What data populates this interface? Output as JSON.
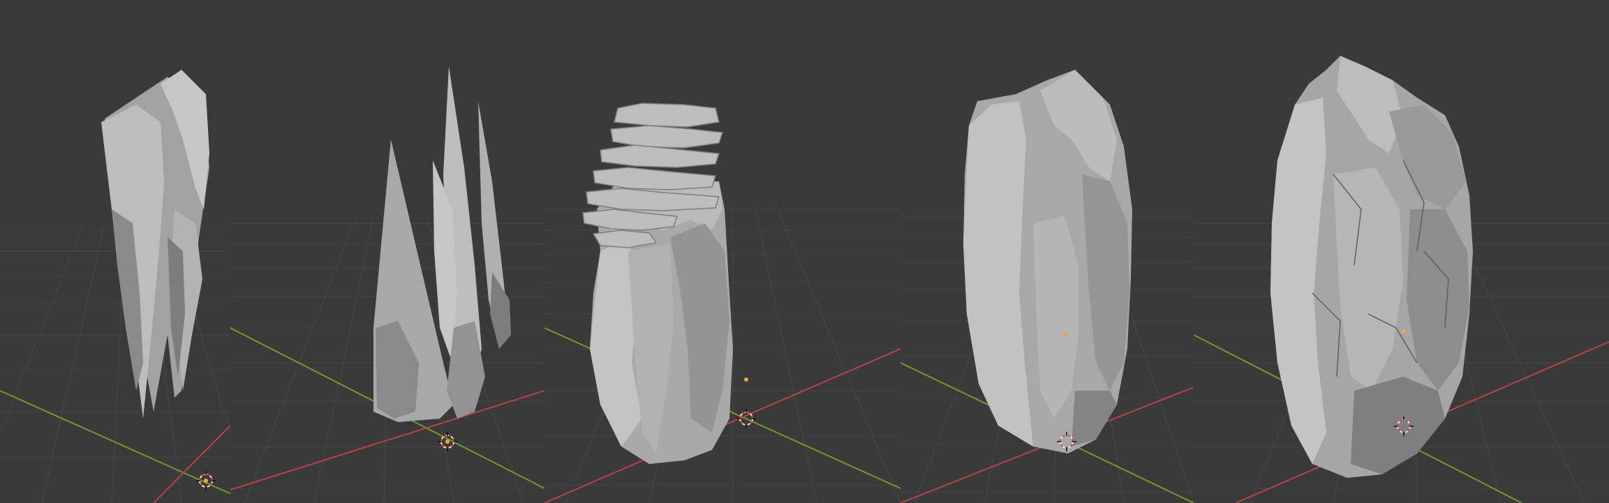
{
  "app": {
    "name": "3D Viewport"
  },
  "colors": {
    "background": "#3a3a3a",
    "background_top": "#393939",
    "grid": "#474747",
    "x_axis": "#b9424a",
    "y_axis": "#6f9b2c",
    "cursor_ring_red": "#d6453f",
    "cursor_ring_white": "#e8e8e8",
    "origin": "#f0a73a",
    "rock_light": "#bdbdbd",
    "rock_mid": "#a2a2a2",
    "rock_dark": "#7d7d7d",
    "rock_shadow": "#5e5e5e"
  },
  "viewports": [
    {
      "object": "rock-crystal-cluster",
      "icons": [
        "3d-cursor-icon",
        "origin-icon"
      ]
    },
    {
      "object": "rock-spire-cluster",
      "icons": [
        "3d-cursor-icon",
        "origin-icon"
      ]
    },
    {
      "object": "rock-layered-pillar",
      "icons": [
        "3d-cursor-icon",
        "origin-icon"
      ]
    },
    {
      "object": "rock-boulder-smooth",
      "icons": [
        "3d-cursor-icon",
        "origin-icon"
      ]
    },
    {
      "object": "rock-boulder-cracked",
      "icons": [
        "3d-cursor-icon",
        "origin-icon"
      ]
    }
  ]
}
